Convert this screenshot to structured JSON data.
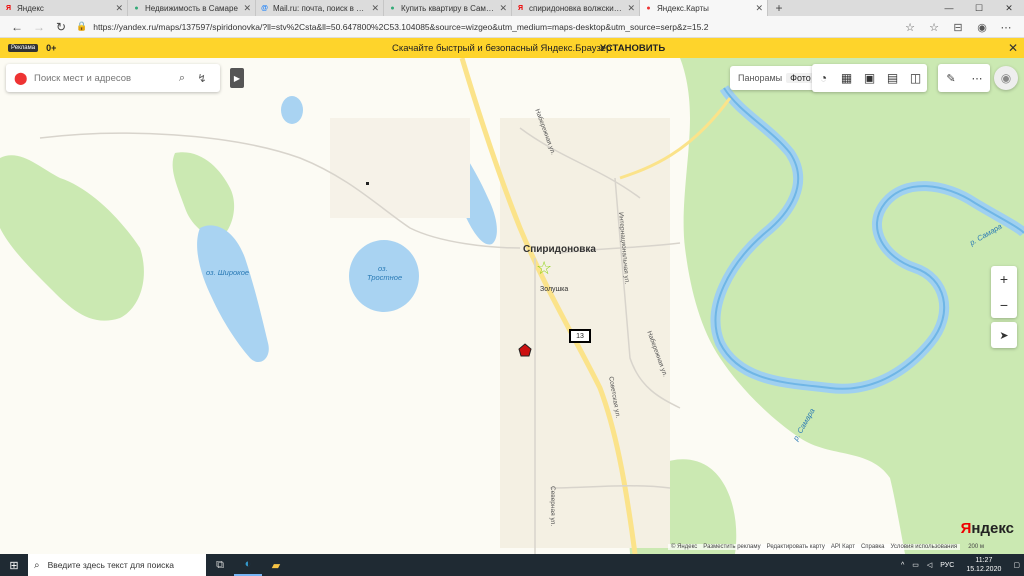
{
  "browser": {
    "tabs": [
      {
        "icon": "yandex-icon",
        "title": "Яндекс",
        "active": false
      },
      {
        "icon": "avito-icon",
        "title": "Недвижимость в Самаре",
        "active": false
      },
      {
        "icon": "mail-icon",
        "title": "Mail.ru: почта, поиск в интернете",
        "active": false
      },
      {
        "icon": "avito-icon",
        "title": "Купить квартиру в Самаре",
        "active": false
      },
      {
        "icon": "yandex-icon",
        "title": "спиридоновка волжский район",
        "active": false
      },
      {
        "icon": "yandex-maps-icon",
        "title": "Яндекс.Карты",
        "active": true
      }
    ],
    "new_tab_label": "+",
    "url": "https://yandex.ru/maps/137597/spiridonovka/?ll=stv%2Csta&ll=50.647800%2C53.104085&source=wizgeo&utm_medium=maps-desktop&utm_source=serp&z=15.2"
  },
  "banner": {
    "ad_tag": "Реклама",
    "age": "0+",
    "message": "Скачайте быстрый и безопасный Яндекс.Браузер",
    "install": "УСТАНОВИТЬ"
  },
  "map": {
    "search_placeholder": "Поиск мест и адресов",
    "layers": {
      "panorama": "Панорамы",
      "photo": "Фото"
    },
    "zoom_in": "+",
    "zoom_out": "−",
    "labels": {
      "village": "Спиридоновка",
      "lake_wide": "оз. Широкое",
      "lake_trost_1": "оз.",
      "lake_trost_2": "Тростное",
      "poi_zolushka": "Золушка",
      "marker_13": "13",
      "river_1": "р. Самара",
      "river_2": "р. Самара",
      "street_naber": "Набережная ул.",
      "street_internat": "Интернациональная ул.",
      "street_naber2": "Набережная ул.",
      "street_sov": "Советская ул.",
      "street_sev": "Северная ул."
    },
    "logo_ya": "Я",
    "logo_rest": "ндекс",
    "footer": {
      "copyright": "© Яндекс",
      "ad": "Разместить рекламу",
      "edit": "Редактировать карту",
      "api": "API Карт",
      "help": "Справка",
      "terms": "Условия использования"
    },
    "scale": "200 м"
  },
  "taskbar": {
    "search_placeholder": "Введите здесь текст для поиска",
    "lang": "РУС",
    "time": "11:27",
    "date": "15.12.2020"
  }
}
